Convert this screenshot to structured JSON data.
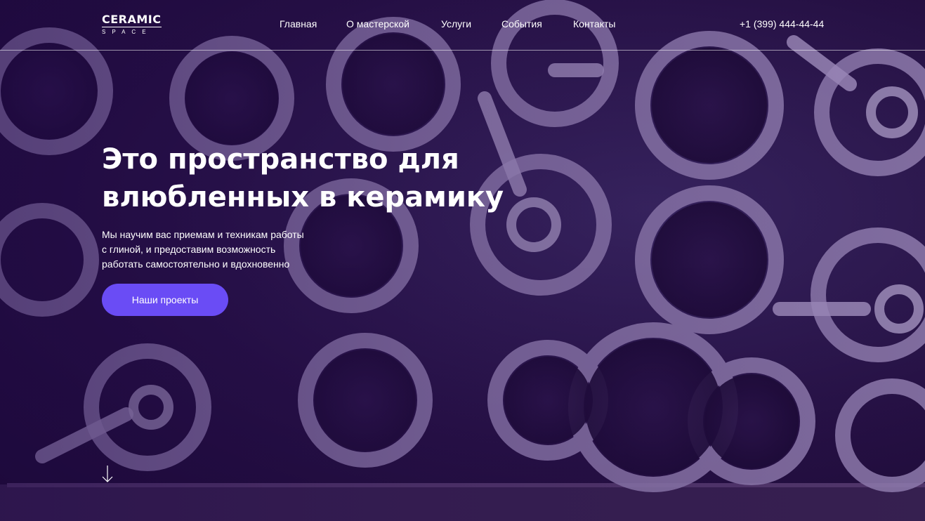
{
  "header": {
    "logo_main": "CERAMIC",
    "logo_sub": "SPACE",
    "nav": [
      {
        "label": "Главная"
      },
      {
        "label": "О мастерской"
      },
      {
        "label": "Услуги"
      },
      {
        "label": "События"
      },
      {
        "label": "Контакты"
      }
    ],
    "phone": "+1 (399) 444-44-44"
  },
  "hero": {
    "title_line1": "Это пространство для",
    "title_line2": "влюбленных в керамику",
    "subtitle_line1": "Мы научим вас приемам и техникам работы",
    "subtitle_line2": "с глиной, и предоставим возможность",
    "subtitle_line3": "работать самостоятельно и вдохновенно",
    "cta_label": "Наши проекты",
    "scroll_icon": "arrow-down-icon"
  },
  "colors": {
    "accent": "#6a4cf5",
    "overlay": "#2a1050",
    "text": "#ffffff"
  }
}
